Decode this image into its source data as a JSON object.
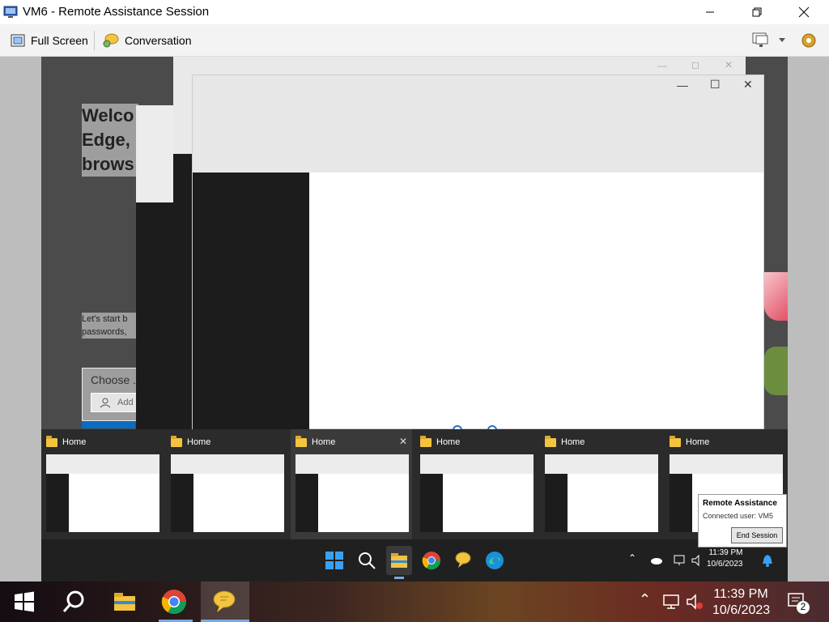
{
  "window": {
    "title": "VM6 - Remote Assistance Session"
  },
  "toolbar": {
    "full_screen_label": "Full Screen",
    "conversation_label": "Conversation"
  },
  "remote_desktop": {
    "welcome_lines": [
      "Welco",
      "Edge,",
      "brows"
    ],
    "small_text_lines": [
      "Let's start b",
      "passwords, "
    ],
    "choose_label": "Choose .",
    "add_placeholder": "Add"
  },
  "thumbnails": [
    {
      "title": "Home",
      "has_close": false
    },
    {
      "title": "Home",
      "has_close": false
    },
    {
      "title": "Home",
      "has_close": true
    },
    {
      "title": "Home",
      "has_close": false
    },
    {
      "title": "Home",
      "has_close": false
    },
    {
      "title": "Home",
      "has_close": false
    }
  ],
  "inner_taskbar": {
    "time": "11:39 PM",
    "date": "10/6/2023"
  },
  "popup": {
    "title": "Remote Assistance",
    "text": "Connected user: VM5",
    "button": "End Session"
  },
  "taskbar": {
    "time": "11:39 PM",
    "date": "10/6/2023",
    "notification_count": "2"
  },
  "colors": {
    "accent": "#0b6cc2",
    "taskbar_underline": "#7aa9e2"
  }
}
